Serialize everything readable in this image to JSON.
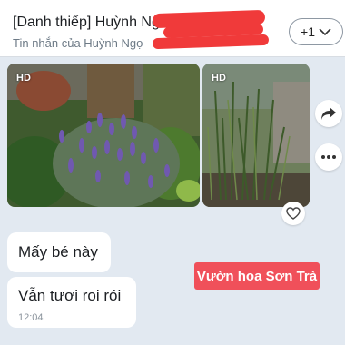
{
  "header": {
    "title": "[Danh thiếp] Huỳnh Ng",
    "subtitle": "Tin nhắn của Huỳnh Ngọ",
    "more_count": "+1"
  },
  "photos": [
    {
      "badge": "HD"
    },
    {
      "badge": "HD"
    }
  ],
  "messages": [
    {
      "text": "Mấy bé này"
    },
    {
      "text": "Vẫn tươi roi rói",
      "time": "12:04"
    }
  ],
  "watermark": {
    "text": "Vườn hoa Sơn Trà",
    "color": "#f0505a"
  },
  "colors": {
    "background": "#e2e9f1",
    "redaction": "#f03a3a"
  },
  "icons": [
    "chevron-down-icon",
    "share-icon",
    "more-icon",
    "heart-icon"
  ]
}
